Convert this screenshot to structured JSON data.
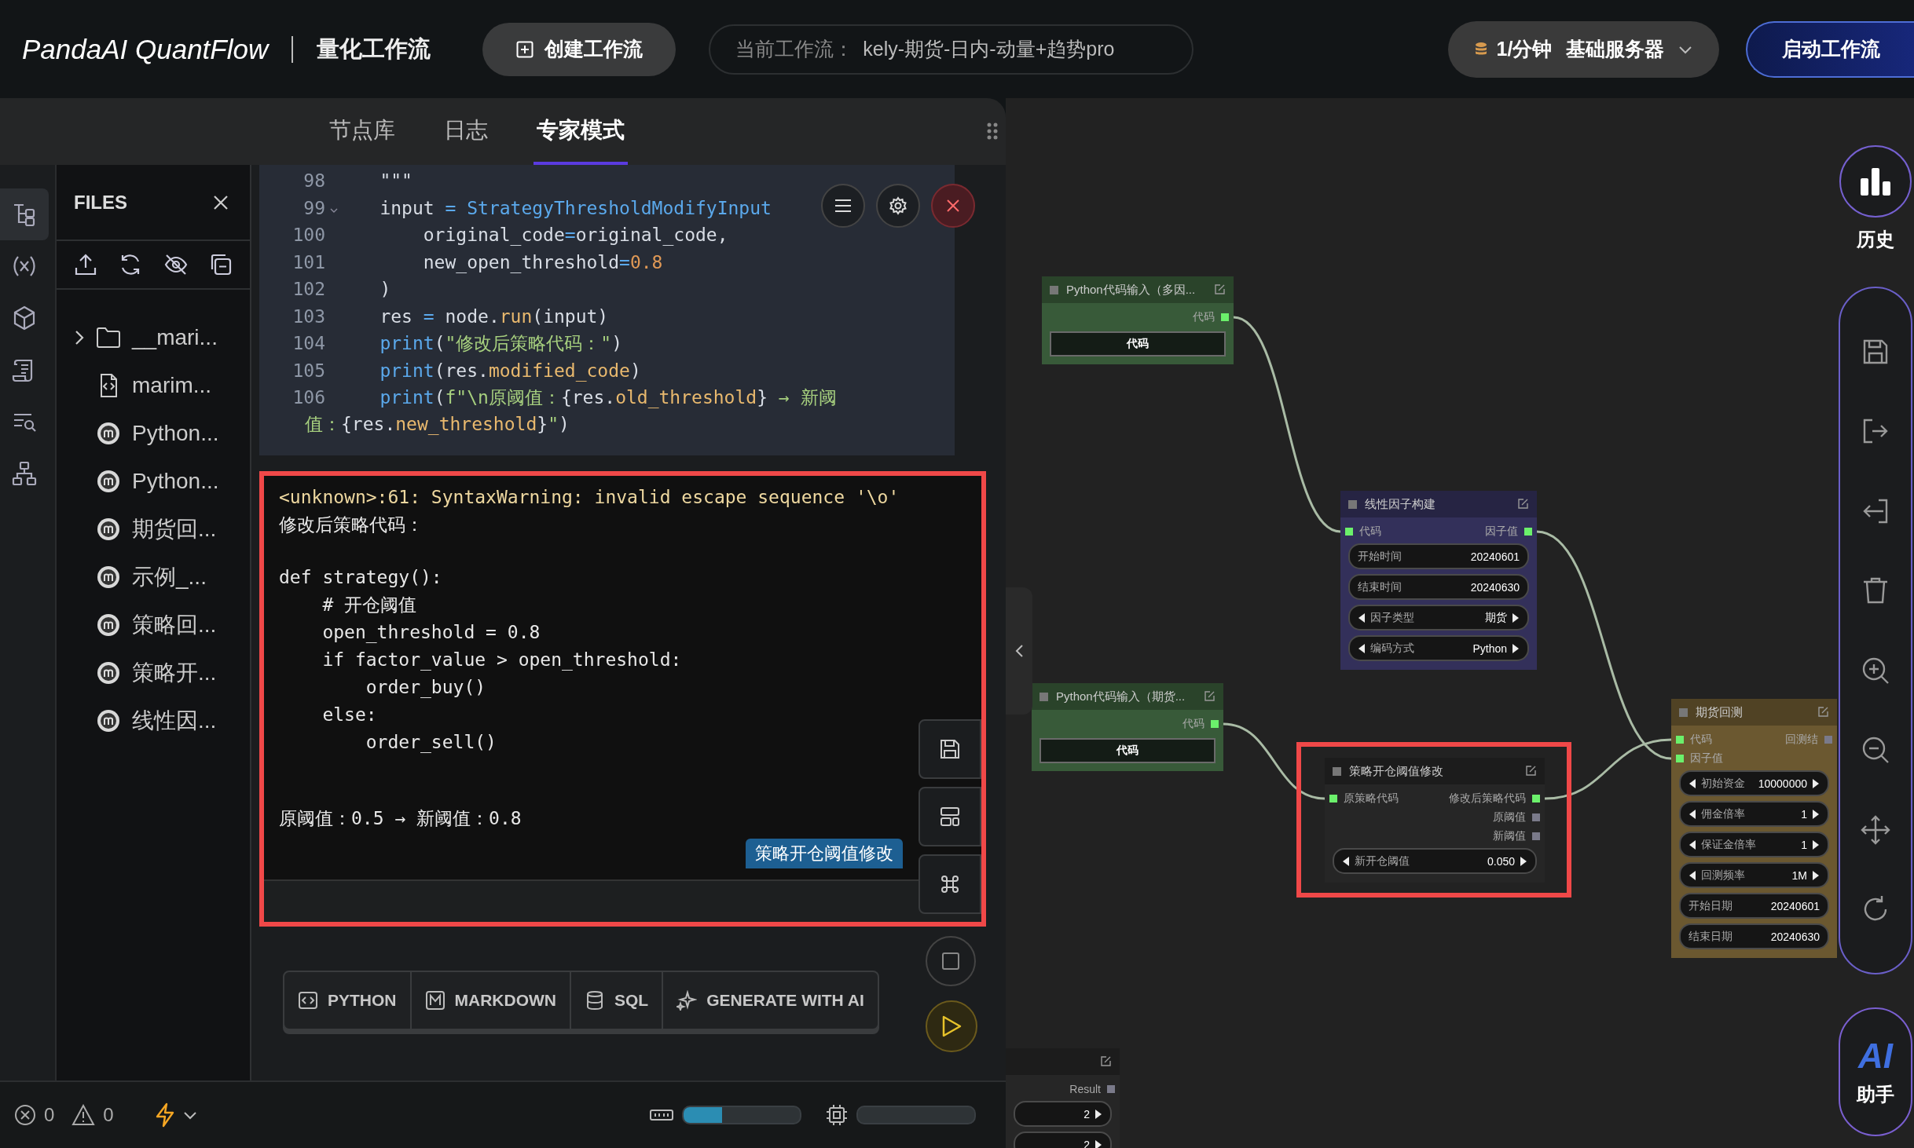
{
  "header": {
    "logo": "PandaAI QuantFlow",
    "subtitle": "量化工作流",
    "create_button": "创建工作流",
    "workflow_label": "当前工作流：",
    "workflow_name": "kely-期货-日内-动量+趋势pro",
    "server_rate": "1/分钟",
    "server_name": "基础服务器",
    "start_button": "启动工作流"
  },
  "panel_tabs": [
    {
      "label": "节点库",
      "selected": false
    },
    {
      "label": "日志",
      "selected": false
    },
    {
      "label": "专家模式",
      "selected": true
    }
  ],
  "activity_bar": [
    {
      "kind": "files",
      "selected": true
    },
    {
      "kind": "variables",
      "selected": false
    },
    {
      "kind": "package",
      "selected": false
    },
    {
      "kind": "scroll",
      "selected": false
    },
    {
      "kind": "search",
      "selected": false
    },
    {
      "kind": "tree",
      "selected": false
    }
  ],
  "files": {
    "title": "FILES",
    "items": [
      {
        "kind": "folder",
        "name": "__mari...",
        "expanded": false
      },
      {
        "kind": "file",
        "name": "marim..."
      },
      {
        "kind": "notebook",
        "name": "Python..."
      },
      {
        "kind": "notebook",
        "name": "Python..."
      },
      {
        "kind": "notebook",
        "name": "期货回..."
      },
      {
        "kind": "notebook",
        "name": "示例_..."
      },
      {
        "kind": "notebook",
        "name": "策略回..."
      },
      {
        "kind": "notebook",
        "name": "策略开..."
      },
      {
        "kind": "notebook",
        "name": "线性因..."
      }
    ]
  },
  "code_cell": {
    "lines": [
      {
        "n": "98",
        "tokens": [
          {
            "kind": "plain",
            "text": "    \"\"\""
          }
        ]
      },
      {
        "n": "99",
        "foldable": true,
        "tokens": [
          {
            "kind": "plain",
            "text": "    input "
          },
          {
            "kind": "op",
            "text": "="
          },
          {
            "kind": "name",
            "text": " StrategyThresholdModifyInput"
          }
        ]
      },
      {
        "n": "100",
        "tokens": [
          {
            "kind": "plain",
            "text": "        original_code"
          },
          {
            "kind": "op",
            "text": "="
          },
          {
            "kind": "plain",
            "text": "original_code,"
          }
        ]
      },
      {
        "n": "101",
        "tokens": [
          {
            "kind": "plain",
            "text": "        new_open_threshold"
          },
          {
            "kind": "op",
            "text": "="
          },
          {
            "kind": "number",
            "text": "0.8"
          }
        ]
      },
      {
        "n": "102",
        "tokens": [
          {
            "kind": "plain",
            "text": "    )"
          }
        ]
      },
      {
        "n": "103",
        "tokens": [
          {
            "kind": "plain",
            "text": "    res "
          },
          {
            "kind": "op",
            "text": "="
          },
          {
            "kind": "plain",
            "text": " node."
          },
          {
            "kind": "attr",
            "text": "run"
          },
          {
            "kind": "plain",
            "text": "(input)"
          }
        ]
      },
      {
        "n": "104",
        "tokens": [
          {
            "kind": "name",
            "text": "    print"
          },
          {
            "kind": "plain",
            "text": "("
          },
          {
            "kind": "string",
            "text": "\"修改后策略代码：\""
          },
          {
            "kind": "plain",
            "text": ")"
          }
        ]
      },
      {
        "n": "105",
        "tokens": [
          {
            "kind": "name",
            "text": "    print"
          },
          {
            "kind": "plain",
            "text": "(res."
          },
          {
            "kind": "attr",
            "text": "modified_code"
          },
          {
            "kind": "plain",
            "text": ")"
          }
        ]
      },
      {
        "n": "106",
        "tokens": [
          {
            "kind": "name",
            "text": "    print"
          },
          {
            "kind": "plain",
            "text": "("
          },
          {
            "kind": "string",
            "text": "f\"\\n原阈值："
          },
          {
            "kind": "plain",
            "text": "{res."
          },
          {
            "kind": "attr",
            "text": "old_threshold"
          },
          {
            "kind": "plain",
            "text": "}"
          },
          {
            "kind": "string",
            "text": " → 新阈"
          }
        ]
      },
      {
        "tokens": [
          {
            "kind": "string",
            "text": "值："
          },
          {
            "kind": "plain",
            "text": "{res."
          },
          {
            "kind": "attr",
            "text": "new_threshold"
          },
          {
            "kind": "plain",
            "text": "}"
          },
          {
            "kind": "string",
            "text": "\""
          },
          {
            "kind": "plain",
            "text": ")"
          }
        ]
      }
    ]
  },
  "output": {
    "highlighted": true,
    "blocks": [
      {
        "kind": "warning",
        "text": "<unknown>:61: SyntaxWarning: invalid escape sequence '\\o'"
      },
      {
        "kind": "text",
        "text": "修改后策略代码："
      },
      {
        "kind": "code",
        "text": "def strategy():\n    # 开仓阈值\n    open_threshold = 0.8\n    if factor_value > open_threshold:\n        order_buy()\n    else:\n        order_sell()"
      },
      {
        "kind": "text",
        "text": "原阈值：0.5 → 新阈值：0.8"
      }
    ],
    "cell_name": "策略开仓阈值修改"
  },
  "add_cell_buttons": [
    {
      "kind": "python",
      "label": "PYTHON"
    },
    {
      "kind": "markdown",
      "label": "MARKDOWN"
    },
    {
      "kind": "sql",
      "label": "SQL"
    },
    {
      "kind": "ai",
      "label": "GENERATE WITH AI"
    }
  ],
  "status_bar": {
    "errors": "0",
    "warnings": "0",
    "memory": {
      "level": 0.33
    },
    "cpu": {
      "level": 0.0
    }
  },
  "canvas": {
    "nodes": [
      {
        "title": "Python代码输入（多因...",
        "color": "#385a39",
        "outputs": [
          {
            "label": "代码",
            "connected": true
          }
        ],
        "widgets": [
          {
            "kind": "text",
            "label": "代码"
          }
        ]
      },
      {
        "title": "线性因子构建",
        "color": "#33305a",
        "inputs": [
          {
            "label": "代码",
            "connected": true
          }
        ],
        "outputs": [
          {
            "label": "因子值",
            "connected": true
          }
        ],
        "widgets": [
          {
            "kind": "value",
            "label": "开始时间",
            "value": "20240601"
          },
          {
            "kind": "value",
            "label": "结束时间",
            "value": "20240630"
          },
          {
            "kind": "combo",
            "label": "因子类型",
            "value": "期货"
          },
          {
            "kind": "combo",
            "label": "编码方式",
            "value": "Python"
          }
        ]
      },
      {
        "title": "Python代码输入（期货...",
        "color": "#385a39",
        "outputs": [
          {
            "label": "代码",
            "connected": true
          }
        ],
        "widgets": [
          {
            "kind": "text",
            "label": "代码"
          }
        ]
      },
      {
        "title": "策略开仓阈值修改",
        "color": "#262626",
        "highlighted": true,
        "inputs": [
          {
            "label": "原策略代码",
            "connected": true
          }
        ],
        "outputs": [
          {
            "label": "修改后策略代码",
            "connected": true
          },
          {
            "label": "原阈值",
            "connected": false
          },
          {
            "label": "新阈值",
            "connected": false
          }
        ],
        "widgets": [
          {
            "kind": "combo",
            "label": "新开仓阈值",
            "value": "0.050"
          }
        ]
      },
      {
        "title": "期货回测",
        "color": "#6b5830",
        "inputs": [
          {
            "label": "代码",
            "connected": true
          },
          {
            "label": "因子值",
            "connected": true
          }
        ],
        "outputs": [
          {
            "label": "回测结",
            "connected": false
          }
        ],
        "widgets": [
          {
            "kind": "combo",
            "label": "初始资金",
            "value": "10000000"
          },
          {
            "kind": "combo",
            "label": "佣金倍率",
            "value": "1"
          },
          {
            "kind": "combo",
            "label": "保证金倍率",
            "value": "1"
          },
          {
            "kind": "combo",
            "label": "回测频率",
            "value": "1M"
          },
          {
            "kind": "value",
            "label": "开始日期",
            "value": "20240601"
          },
          {
            "kind": "value",
            "label": "结束日期",
            "value": "20240630"
          }
        ]
      },
      {
        "color": "#262626",
        "outputs": [
          {
            "label": "Result",
            "connected": false
          }
        ],
        "widgets": [
          {
            "kind": "combo",
            "value": "2"
          },
          {
            "kind": "combo",
            "value": "2"
          }
        ]
      }
    ]
  },
  "right_toolbar": {
    "history_label": "历史",
    "ai_label": "AI",
    "ai_caption": "助手"
  }
}
